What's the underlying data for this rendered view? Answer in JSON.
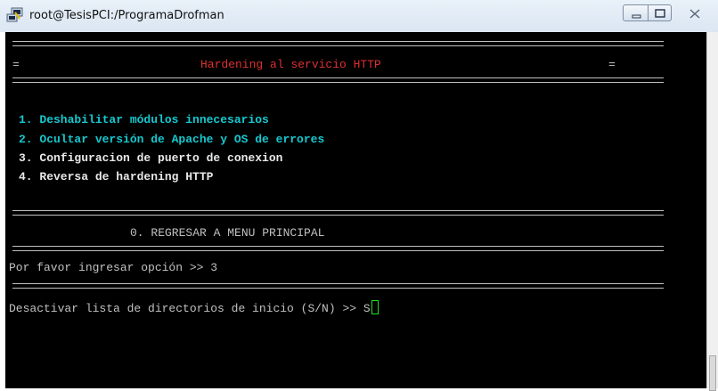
{
  "window": {
    "title": "root@TesisPCI:/ProgramaDrofman",
    "icon": "putty-icon"
  },
  "header": {
    "left_marker": "=",
    "title": "Hardening al servicio HTTP",
    "right_marker": "="
  },
  "menu": {
    "items": [
      "1. Deshabilitar módulos innecesarios",
      "2. Ocultar versión de Apache y OS de errores",
      "3. Configuracion de puerto de conexion",
      "4. Reversa de hardening HTTP"
    ],
    "back": "0. REGRESAR A MENU PRINCIPAL"
  },
  "prompt": {
    "text": "Por favor ingresar opción >> 3"
  },
  "question": {
    "text": "Desactivar lista de directorios de inicio (S/N) >> S"
  },
  "colors": {
    "title": "#e0302e",
    "highlight": "#16c8cf",
    "text": "#c0c0c0",
    "cursor": "#20e020"
  }
}
